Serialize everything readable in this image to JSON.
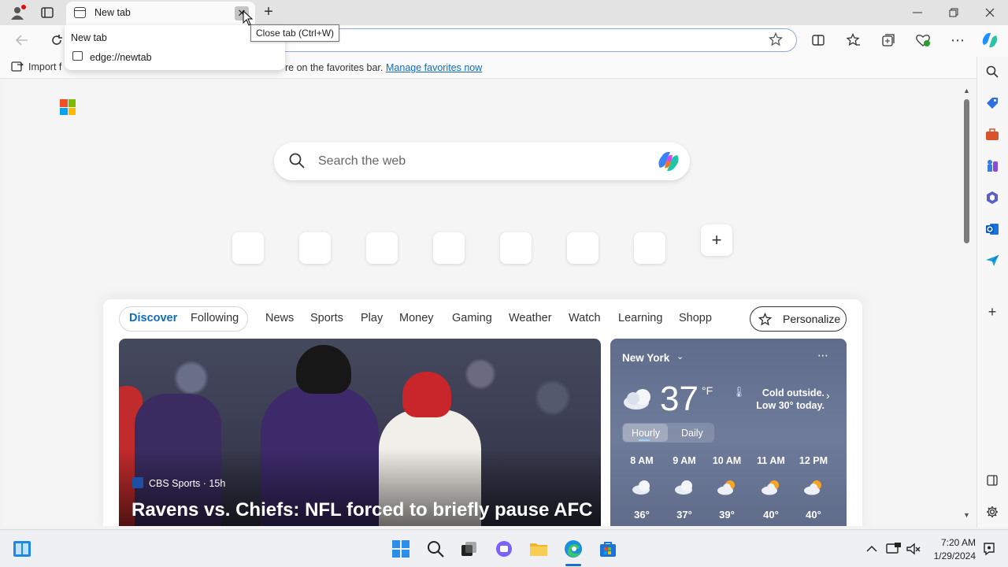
{
  "browser": {
    "tab_title": "New tab",
    "new_tab_symbol": "+",
    "close_symbol": "✕"
  },
  "tooltip": {
    "text": "Close tab (Ctrl+W)"
  },
  "hover_card": {
    "title": "New tab",
    "url": "edge://newtab"
  },
  "favorites_bar": {
    "import_label": "Import f",
    "message": "re on the favorites bar.",
    "manage_link": "Manage favorites now"
  },
  "newtab": {
    "search_placeholder": "Search the web",
    "add_shortcut_symbol": "+"
  },
  "feed": {
    "tabs": [
      "Discover",
      "Following"
    ],
    "categories": [
      "News",
      "Sports",
      "Play",
      "Money",
      "Gaming",
      "Weather",
      "Watch",
      "Learning",
      "Shopp"
    ],
    "personalize_label": "Personalize",
    "active_color": "#0f6cbd"
  },
  "hero": {
    "source": "CBS Sports · 15h",
    "headline": "Ravens vs. Chiefs: NFL forced to briefly pause AFC"
  },
  "weather": {
    "city": "New York",
    "temperature": "37",
    "unit": "°F",
    "note": "Cold outside. Low 30° today.",
    "tabs": [
      "Hourly",
      "Daily"
    ],
    "hourly": [
      {
        "time": "8 AM",
        "temp": "36°",
        "icon": "cloudy-icon"
      },
      {
        "time": "9 AM",
        "temp": "37°",
        "icon": "cloudy-icon"
      },
      {
        "time": "10 AM",
        "temp": "39°",
        "icon": "partly-sunny-icon"
      },
      {
        "time": "11 AM",
        "temp": "40°",
        "icon": "partly-sunny-icon"
      },
      {
        "time": "12 PM",
        "temp": "40°",
        "icon": "partly-sunny-icon"
      }
    ]
  },
  "taskbar": {
    "time": "7:20 AM",
    "date": "1/29/2024"
  }
}
